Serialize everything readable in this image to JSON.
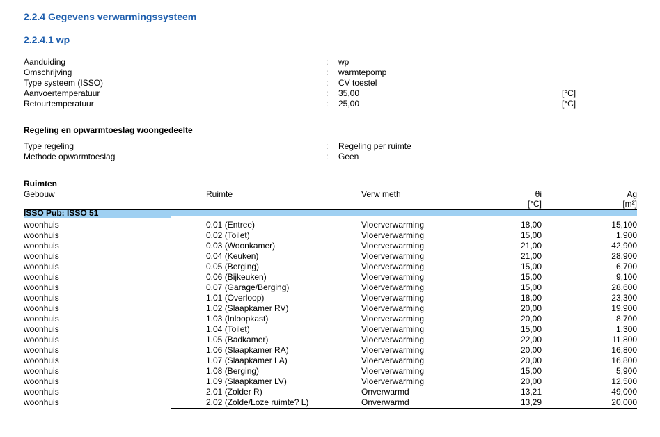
{
  "heading1": "2.2.4 Gegevens verwarmingssysteem",
  "heading2": "2.2.4.1 wp",
  "general": [
    {
      "label": "Aanduiding",
      "colon": ":",
      "value": "wp",
      "unit": ""
    },
    {
      "label": "Omschrijving",
      "colon": ":",
      "value": "warmtepomp",
      "unit": ""
    },
    {
      "label": "Type systeem (ISSO)",
      "colon": ":",
      "value": "CV toestel",
      "unit": ""
    },
    {
      "label": "Aanvoertemperatuur",
      "colon": ":",
      "value": "35,00",
      "unit": "[°C]"
    },
    {
      "label": "Retourtemperatuur",
      "colon": ":",
      "value": "25,00",
      "unit": "[°C]"
    }
  ],
  "regeling_title": "Regeling en opwarmtoeslag woongedeelte",
  "regeling": [
    {
      "label": "Type regeling",
      "colon": ":",
      "value": "Regeling per ruimte"
    },
    {
      "label": "Methode opwarmtoeslag",
      "colon": ":",
      "value": "Geen"
    }
  ],
  "ruimten_title": "Ruimten",
  "table_header": {
    "gebouw": "Gebouw",
    "ruimte": "Ruimte",
    "verw": "Verw meth",
    "theta": "θi",
    "theta_unit": "[°C]",
    "area": "Ag",
    "area_unit": "[m²]"
  },
  "isso_label": "ISSO Pub: ISSO 51",
  "rows": [
    {
      "gebouw": "woonhuis",
      "ruimte": "0.01 (Entree)",
      "verw": "Vloerverwarming",
      "theta": "18,00",
      "area": "15,100"
    },
    {
      "gebouw": "woonhuis",
      "ruimte": "0.02 (Toilet)",
      "verw": "Vloerverwarming",
      "theta": "15,00",
      "area": "1,900"
    },
    {
      "gebouw": "woonhuis",
      "ruimte": "0.03 (Woonkamer)",
      "verw": "Vloerverwarming",
      "theta": "21,00",
      "area": "42,900"
    },
    {
      "gebouw": "woonhuis",
      "ruimte": "0.04 (Keuken)",
      "verw": "Vloerverwarming",
      "theta": "21,00",
      "area": "28,900"
    },
    {
      "gebouw": "woonhuis",
      "ruimte": "0.05 (Berging)",
      "verw": "Vloerverwarming",
      "theta": "15,00",
      "area": "6,700"
    },
    {
      "gebouw": "woonhuis",
      "ruimte": "0.06 (Bijkeuken)",
      "verw": "Vloerverwarming",
      "theta": "15,00",
      "area": "9,100"
    },
    {
      "gebouw": "woonhuis",
      "ruimte": "0.07 (Garage/Berging)",
      "verw": "Vloerverwarming",
      "theta": "15,00",
      "area": "28,600"
    },
    {
      "gebouw": "woonhuis",
      "ruimte": "1.01 (Overloop)",
      "verw": "Vloerverwarming",
      "theta": "18,00",
      "area": "23,300"
    },
    {
      "gebouw": "woonhuis",
      "ruimte": "1.02 (Slaapkamer RV)",
      "verw": "Vloerverwarming",
      "theta": "20,00",
      "area": "19,900"
    },
    {
      "gebouw": "woonhuis",
      "ruimte": "1.03 (Inloopkast)",
      "verw": "Vloerverwarming",
      "theta": "20,00",
      "area": "8,700"
    },
    {
      "gebouw": "woonhuis",
      "ruimte": "1.04 (Toilet)",
      "verw": "Vloerverwarming",
      "theta": "15,00",
      "area": "1,300"
    },
    {
      "gebouw": "woonhuis",
      "ruimte": "1.05 (Badkamer)",
      "verw": "Vloerverwarming",
      "theta": "22,00",
      "area": "11,800"
    },
    {
      "gebouw": "woonhuis",
      "ruimte": "1.06 (Slaapkamer RA)",
      "verw": "Vloerverwarming",
      "theta": "20,00",
      "area": "16,800"
    },
    {
      "gebouw": "woonhuis",
      "ruimte": "1.07 (Slaapkamer LA)",
      "verw": "Vloerverwarming",
      "theta": "20,00",
      "area": "16,800"
    },
    {
      "gebouw": "woonhuis",
      "ruimte": "1.08 (Berging)",
      "verw": "Vloerverwarming",
      "theta": "15,00",
      "area": "5,900"
    },
    {
      "gebouw": "woonhuis",
      "ruimte": "1.09 (Slaapkamer LV)",
      "verw": "Vloerverwarming",
      "theta": "20,00",
      "area": "12,500"
    },
    {
      "gebouw": "woonhuis",
      "ruimte": "2.01 (Zolder R)",
      "verw": "Onverwarmd",
      "theta": "13,21",
      "area": "49,000"
    },
    {
      "gebouw": "woonhuis",
      "ruimte": "2.02 (Zolde/Loze ruimte?  L)",
      "verw": "Onverwarmd",
      "theta": "13,29",
      "area": "20,000"
    }
  ],
  "colors": {
    "heading": "#1f5fae",
    "isso_bar": "#9fd0f2"
  }
}
